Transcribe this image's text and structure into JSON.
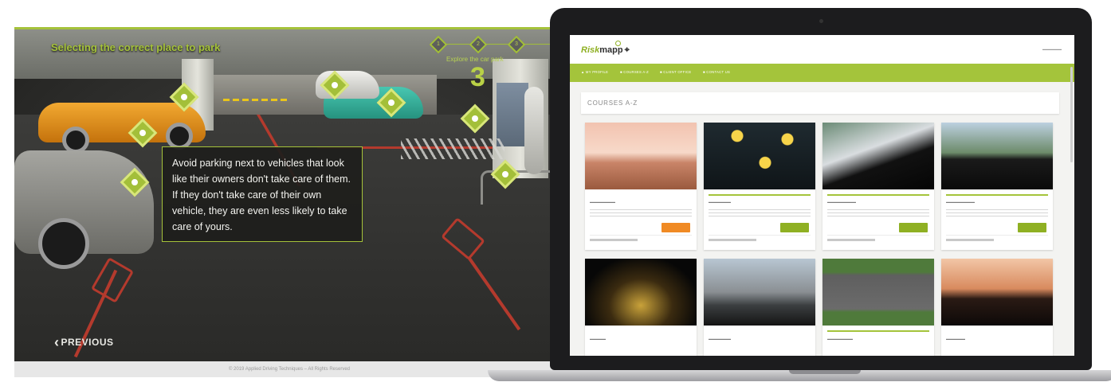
{
  "module": {
    "title": "Selecting the correct place to park",
    "explore_label": "Explore the car park",
    "progress_number": "3",
    "steps": [
      "1",
      "2",
      "3"
    ],
    "tip_text": "Avoid parking next to vehicles that look like their owners don't take care of them. If they don't take care of their own vehicle, they are even less likely to take care of yours.",
    "previous_label": "PREVIOUS",
    "footer_text": "© 2019 Applied Driving Techniques – All Rights Reserved",
    "accent_color": "#a5c23a"
  },
  "site": {
    "logo_prefix": "Risk",
    "logo_suffix": "mapp",
    "nav": [
      "MY PROFILE",
      "COURSES A-Z",
      "CLIENT OFFICE",
      "CONTACT US"
    ],
    "courses_heading": "COURSES A-Z",
    "brand_color": "#a4c43b",
    "cards": [
      {
        "theme": "desert-road",
        "button": "orange"
      },
      {
        "theme": "driver-thoughts",
        "button": "green"
      },
      {
        "theme": "steering-hands",
        "button": "green"
      },
      {
        "theme": "truck-sign",
        "button": "green"
      },
      {
        "theme": "night-road",
        "button": "none"
      },
      {
        "theme": "town-street",
        "button": "none"
      },
      {
        "theme": "motorway",
        "button": "none"
      },
      {
        "theme": "dashboard-sunset",
        "button": "none"
      }
    ]
  }
}
